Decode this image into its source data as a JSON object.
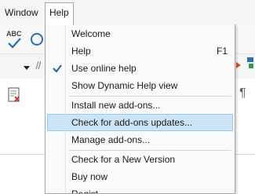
{
  "menubar": {
    "items": [
      {
        "label": "Window"
      },
      {
        "label": "Help"
      }
    ]
  },
  "toolbar": {
    "spellcheck_icon_text": "ABC",
    "paragraph_mark": "¶"
  },
  "help_menu": {
    "items": [
      {
        "label": "Welcome",
        "shortcut": "",
        "checked": false
      },
      {
        "label": "Help",
        "shortcut": "F1",
        "checked": false
      },
      {
        "label": "Use online help",
        "shortcut": "",
        "checked": true
      },
      {
        "label": "Show Dynamic Help view",
        "shortcut": "",
        "checked": false
      },
      {
        "label": "Install new add-ons...",
        "shortcut": "",
        "checked": false
      },
      {
        "label": "Check for add-ons updates...",
        "shortcut": "",
        "checked": false,
        "highlighted": true
      },
      {
        "label": "Manage add-ons...",
        "shortcut": "",
        "checked": false
      },
      {
        "label": "Check for a New Version",
        "shortcut": "",
        "checked": false
      },
      {
        "label": "Buy now",
        "shortcut": "",
        "checked": false
      },
      {
        "label": "Regist",
        "shortcut": "",
        "checked": false
      }
    ]
  },
  "colors": {
    "highlight_bg": "#cce4f7",
    "highlight_border": "#99c9ef",
    "check_color": "#1f5fa8"
  }
}
